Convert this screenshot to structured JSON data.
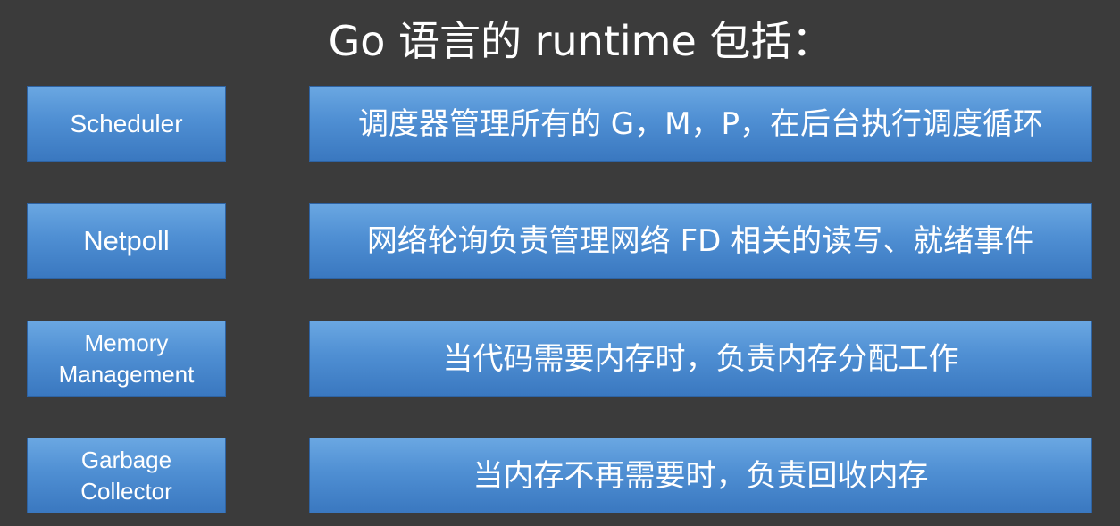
{
  "title": "Go 语言的 runtime 包括：",
  "rows": [
    {
      "component": "Scheduler",
      "description": "调度器管理所有的 G，M，P，在后台执行调度循环"
    },
    {
      "component": "Netpoll",
      "description": "网络轮询负责管理网络 FD 相关的读写、就绪事件"
    },
    {
      "component_lines": [
        "Memory",
        "Management"
      ],
      "description": "当代码需要内存时，负责内存分配工作"
    },
    {
      "component_lines": [
        "Garbage",
        "Collector"
      ],
      "description": "当内存不再需要时，负责回收内存"
    }
  ],
  "colors": {
    "background": "#3b3b3b",
    "box_top": "#6aa7e2",
    "box_bottom": "#3a78c0",
    "text": "#ffffff"
  }
}
